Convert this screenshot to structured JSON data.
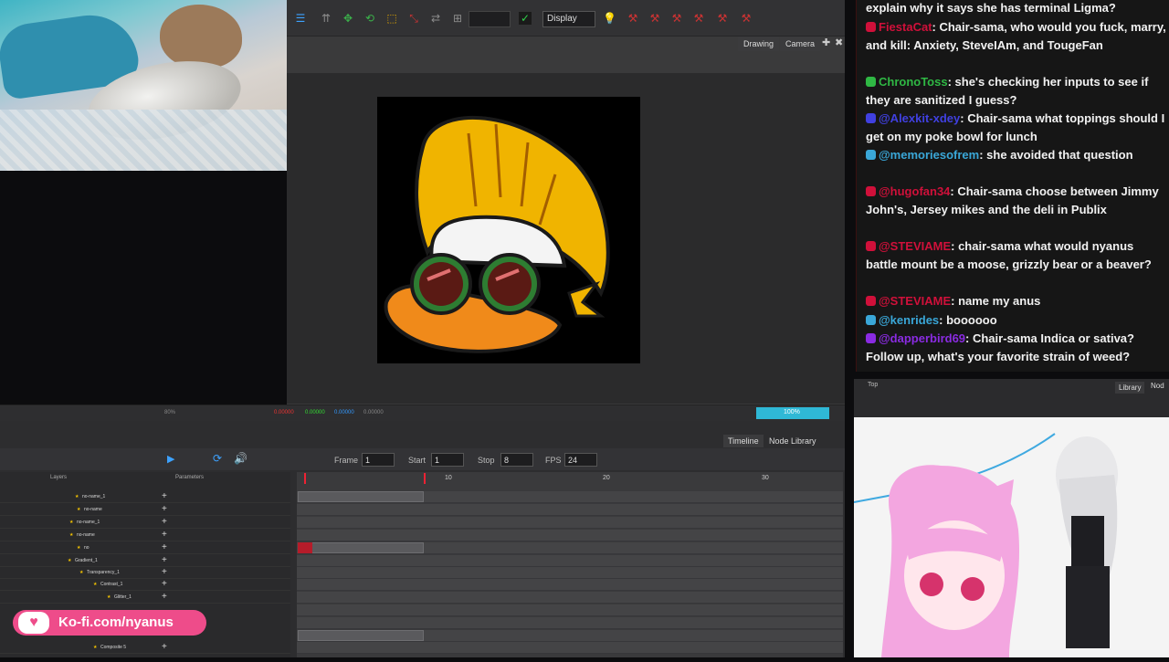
{
  "app": {
    "display_label": "Display",
    "tabs": [
      "Drawing",
      "Camera"
    ],
    "zoom": "80%",
    "progress_label": "100%",
    "progress": 100,
    "status_values": [
      "0.00000",
      "0.00000",
      "0.00000",
      "0.00000"
    ]
  },
  "timeline": {
    "tabs": [
      "Timeline",
      "Node Library"
    ],
    "frame_label": "Frame",
    "frame_value": "1",
    "start_label": "Start",
    "start_value": "1",
    "stop_label": "Stop",
    "stop_value": "8",
    "fps_label": "FPS",
    "fps_value": "24",
    "layers_header": "Layers",
    "params_header": "Parameters",
    "ruler": [
      "10",
      "20",
      "30"
    ],
    "layers": [
      "no-name_1",
      "no-name",
      "no-name_1",
      "no-name",
      "no",
      "Gradient_1",
      "Transparency_1",
      "Contrast_1",
      "Glitter_1",
      "Composite 5"
    ]
  },
  "kofi": {
    "text": "Ko-fi.com/nyanus"
  },
  "chat": {
    "messages": [
      {
        "user": "",
        "text": "explain why it says she has terminal Ligma?",
        "color": "#f1f1f1"
      },
      {
        "user": "FiestaCat",
        "text": ": Chair-sama, who would you fuck, marry, and kill: Anxiety, SteveIAm, and TougeFan",
        "color": "#d0103a"
      },
      {
        "user": "ChronoToss",
        "text": ": she's checking her inputs to see if they are sanitized I guess?",
        "color": "#2fb844"
      },
      {
        "user": "@Alexkit-xdey",
        "text": ": Chair-sama what toppings should I get on my poke bowl for lunch",
        "color": "#4040e0"
      },
      {
        "user": "@memoriesofrem",
        "text": ": she avoided that question",
        "color": "#3aa7d8"
      },
      {
        "user": "@hugofan34",
        "text": ": Chair-sama choose between Jimmy John's, Jersey mikes and the deli in Publix",
        "color": "#d0103a"
      },
      {
        "user": "@STEVIAME",
        "text": ": chair-sama what would nyanus battle mount be a moose, grizzly bear or a beaver?",
        "color": "#d0103a"
      },
      {
        "user": "@STEVIAME",
        "text": ": name my anus",
        "color": "#d0103a"
      },
      {
        "user": "@kenrides",
        "text": ": boooooo",
        "color": "#3aa7d8"
      },
      {
        "user": "@dapperbird69",
        "text": ": Chair-sama Indica or sativa? Follow up, what's your favorite strain of weed?",
        "color": "#8a2be2"
      }
    ]
  },
  "vtuber": {
    "tab_label": "Library",
    "tab2_label": "Nod",
    "top_label": "Top"
  }
}
